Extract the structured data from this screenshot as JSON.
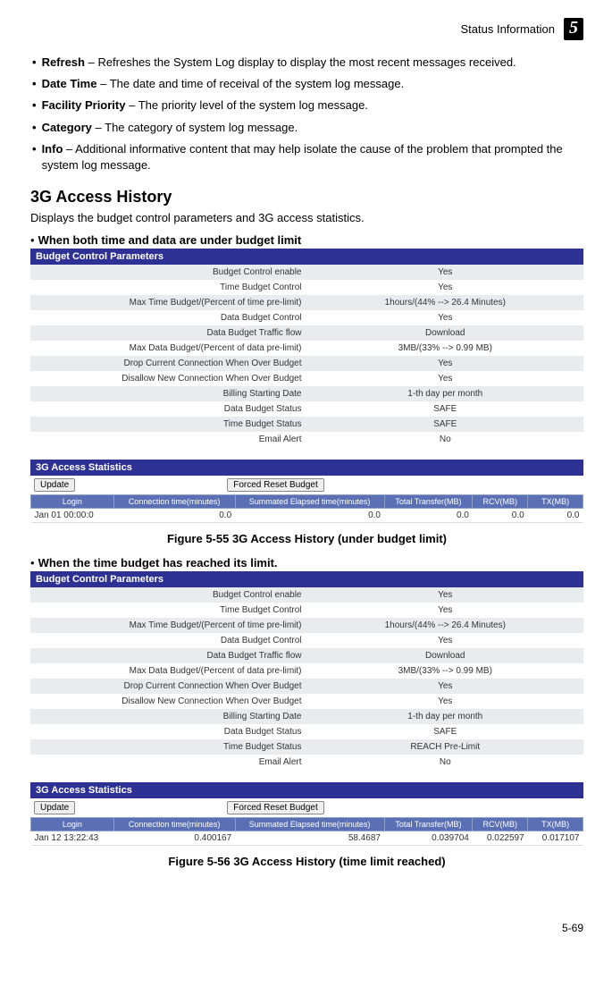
{
  "header": {
    "section": "Status Information",
    "chapter": "5"
  },
  "defs": [
    {
      "term": "Refresh",
      "desc": " – Refreshes the System Log display to display the most recent messages received."
    },
    {
      "term": "Date Time",
      "desc": " – The date and time of receival of the system log message."
    },
    {
      "term": "Facility Priority",
      "desc": " – The priority level of the system log message."
    },
    {
      "term": "Category",
      "desc": " – The category of system log message."
    },
    {
      "term": "Info",
      "desc": " – Additional informative content that may help isolate the cause of the problem that prompted the system log message."
    }
  ],
  "section_title": "3G Access History",
  "section_intro": "Displays the budget control parameters and 3G access statistics.",
  "scenario1": {
    "label": "When both time and data are under budget limit",
    "panel_title": "Budget Control Parameters",
    "rows": [
      {
        "k": "Budget Control enable",
        "v": "Yes"
      },
      {
        "k": "Time Budget Control",
        "v": "Yes"
      },
      {
        "k": "Max Time Budget/(Percent of time pre-limit)",
        "v": "1hours/(44% --> 26.4 Minutes)"
      },
      {
        "k": "Data Budget Control",
        "v": "Yes"
      },
      {
        "k": "Data Budget Traffic flow",
        "v": "Download"
      },
      {
        "k": "Max Data Budget/(Percent of data pre-limit)",
        "v": "3MB/(33% --> 0.99 MB)"
      },
      {
        "k": "Drop Current Connection When Over Budget",
        "v": "Yes"
      },
      {
        "k": "Disallow New Connection When Over Budget",
        "v": "Yes"
      },
      {
        "k": "Billing Starting Date",
        "v": "1-th day per month"
      },
      {
        "k": "Data Budget Status",
        "v": "SAFE"
      },
      {
        "k": "Time Budget Status",
        "v": "SAFE"
      },
      {
        "k": "Email Alert",
        "v": "No"
      }
    ],
    "stats_title": "3G Access Statistics",
    "btn_update": "Update",
    "btn_reset": "Forced Reset Budget",
    "cols": [
      "Login",
      "Connection time(minutes)",
      "Summated Elapsed time(minutes)",
      "Total Transfer(MB)",
      "RCV(MB)",
      "TX(MB)"
    ],
    "row": [
      "Jan 01 00:00:0",
      "0.0",
      "0.0",
      "0.0",
      "0.0",
      "0.0"
    ],
    "caption": "Figure 5-55  3G Access History (under budget limit)"
  },
  "scenario2": {
    "label": "When the time budget has reached its limit.",
    "panel_title": "Budget Control Parameters",
    "rows": [
      {
        "k": "Budget Control enable",
        "v": "Yes"
      },
      {
        "k": "Time Budget Control",
        "v": "Yes"
      },
      {
        "k": "Max Time Budget/(Percent of time pre-limit)",
        "v": "1hours/(44% --> 26.4 Minutes)"
      },
      {
        "k": "Data Budget Control",
        "v": "Yes"
      },
      {
        "k": "Data Budget Traffic flow",
        "v": "Download"
      },
      {
        "k": "Max Data Budget/(Percent of data pre-limit)",
        "v": "3MB/(33% --> 0.99 MB)"
      },
      {
        "k": "Drop Current Connection When Over Budget",
        "v": "Yes"
      },
      {
        "k": "Disallow New Connection When Over Budget",
        "v": "Yes"
      },
      {
        "k": "Billing Starting Date",
        "v": "1-th day per month"
      },
      {
        "k": "Data Budget Status",
        "v": "SAFE"
      },
      {
        "k": "Time Budget Status",
        "v": "REACH Pre-Limit"
      },
      {
        "k": "Email Alert",
        "v": "No"
      }
    ],
    "stats_title": "3G Access Statistics",
    "btn_update": "Update",
    "btn_reset": "Forced Reset Budget",
    "cols": [
      "Login",
      "Connection time(minutes)",
      "Summated Elapsed time(minutes)",
      "Total Transfer(MB)",
      "RCV(MB)",
      "TX(MB)"
    ],
    "row": [
      "Jan 12 13:22:43",
      "0.400167",
      "58.4687",
      "0.039704",
      "0.022597",
      "0.017107"
    ],
    "caption": "Figure 5-56  3G Access History (time limit reached)"
  },
  "footer": "5-69"
}
